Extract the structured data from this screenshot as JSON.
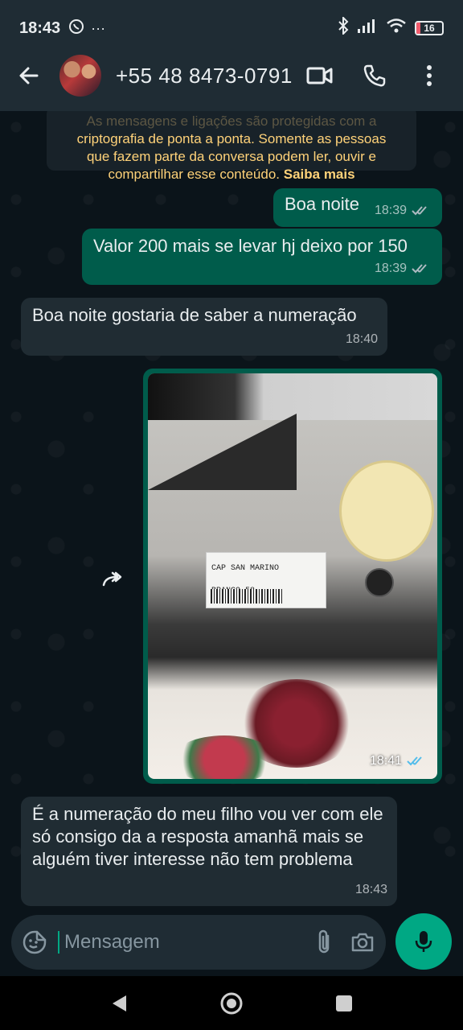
{
  "status_bar": {
    "time": "18:43",
    "dots": "···",
    "battery": "16"
  },
  "header": {
    "contact_name": "+55 48 8473-0791"
  },
  "encryption_notice": {
    "hidden_line": "As mensagens e ligações são protegidas com a",
    "line1": "criptografia de ponta a ponta. Somente as pessoas",
    "line2": "que fazem parte da conversa podem ler, ouvir e",
    "line3": "compartilhar esse conteúdo.",
    "link": "Saiba mais"
  },
  "messages": [
    {
      "direction": "out",
      "text": "Boa noite",
      "time": "18:39",
      "status": "delivered"
    },
    {
      "direction": "out",
      "text": "Valor 200 mais se levar hj deixo por 150",
      "time": "18:39",
      "status": "delivered"
    },
    {
      "direction": "in",
      "text": "Boa noite gostaria de saber a numeração",
      "time": "18:40"
    },
    {
      "direction": "out",
      "type": "image",
      "label_text": "CAP SAN MARINO\nBRANCO 58",
      "time": "18:41",
      "status": "read"
    },
    {
      "direction": "in",
      "text": "É a numeração do meu filho vou ver com ele só consigo da a resposta amanhã mais se alguém tiver interesse não  tem problema",
      "time": "18:43"
    }
  ],
  "composer": {
    "placeholder": "Mensagem"
  },
  "colors": {
    "outgoing_bubble": "#005c4b",
    "incoming_bubble": "#202c33",
    "accent": "#00a884",
    "read_ticks": "#53bdeb"
  }
}
